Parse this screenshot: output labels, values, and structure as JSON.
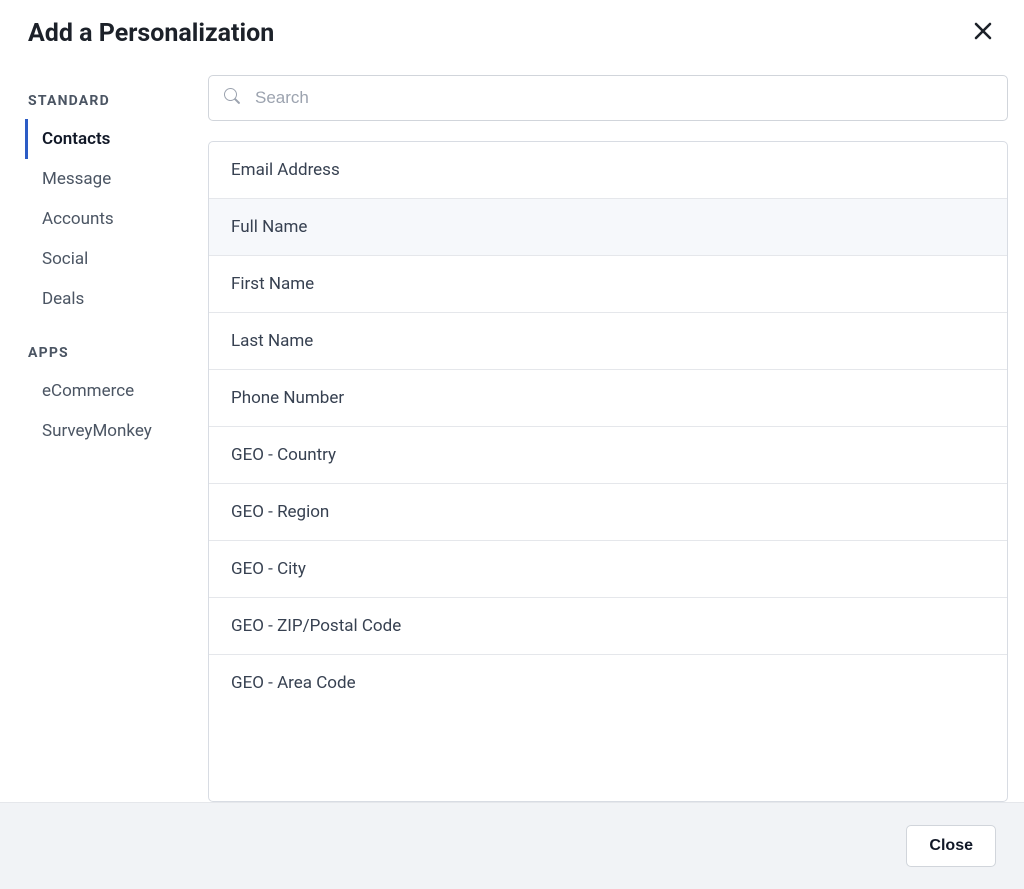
{
  "header": {
    "title": "Add a Personalization"
  },
  "sidebar": {
    "standard_heading": "STANDARD",
    "apps_heading": "APPS",
    "standard_items": [
      {
        "label": "Contacts",
        "active": true
      },
      {
        "label": "Message",
        "active": false
      },
      {
        "label": "Accounts",
        "active": false
      },
      {
        "label": "Social",
        "active": false
      },
      {
        "label": "Deals",
        "active": false
      }
    ],
    "apps_items": [
      {
        "label": "eCommerce",
        "active": false
      },
      {
        "label": "SurveyMonkey",
        "active": false
      }
    ]
  },
  "search": {
    "placeholder": "Search",
    "value": ""
  },
  "list": {
    "items": [
      {
        "label": "Email Address",
        "hovered": false
      },
      {
        "label": "Full Name",
        "hovered": true
      },
      {
        "label": "First Name",
        "hovered": false
      },
      {
        "label": "Last Name",
        "hovered": false
      },
      {
        "label": "Phone Number",
        "hovered": false
      },
      {
        "label": "GEO - Country",
        "hovered": false
      },
      {
        "label": "GEO - Region",
        "hovered": false
      },
      {
        "label": "GEO - City",
        "hovered": false
      },
      {
        "label": "GEO - ZIP/Postal Code",
        "hovered": false
      },
      {
        "label": "GEO - Area Code",
        "hovered": false
      }
    ]
  },
  "footer": {
    "close_label": "Close"
  }
}
